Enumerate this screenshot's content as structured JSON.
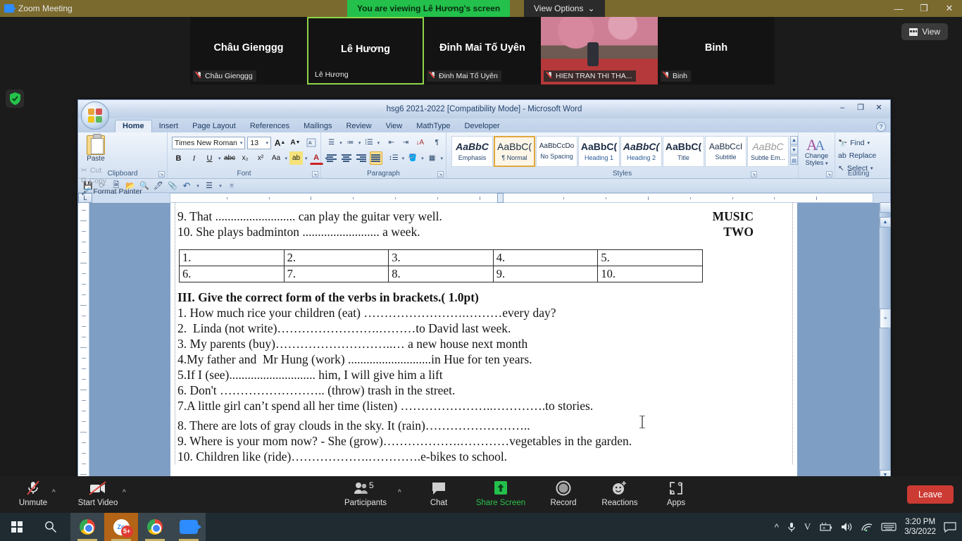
{
  "zoom_app": {
    "titlebar": {
      "app_title": "Zoom Meeting",
      "sharing_banner": "You are viewing Lê Hương's screen",
      "view_options": "View Options",
      "view_options_caret": "⌄",
      "minimize": "—",
      "restore": "❐",
      "close": "✕"
    },
    "view_pill": "View",
    "thumbnails": [
      {
        "big_name": "Châu Gienggg",
        "tag": "Châu Gienggg",
        "muted": true,
        "active": false,
        "has_video": false
      },
      {
        "big_name": "Lê Hương",
        "tag": "Lê Hương",
        "muted": false,
        "active": true,
        "has_video": false
      },
      {
        "big_name": "Đinh Mai Tố Uyên",
        "tag": "Đinh Mai Tố Uyên",
        "muted": true,
        "active": false,
        "has_video": false
      },
      {
        "big_name": "",
        "tag": "HIEN TRAN THI THA...",
        "muted": true,
        "active": false,
        "has_video": true
      },
      {
        "big_name": "Binh",
        "tag": "Binh",
        "muted": true,
        "active": false,
        "has_video": false
      }
    ],
    "toolbar": {
      "unmute": "Unmute",
      "start_video": "Start Video",
      "participants": "Participants",
      "participants_count": "5",
      "chat": "Chat",
      "share_screen": "Share Screen",
      "record": "Record",
      "reactions": "Reactions",
      "apps": "Apps",
      "leave": "Leave",
      "caret": "^"
    }
  },
  "word": {
    "titlebar": {
      "document_title": "hsg6 2021-2022 [Compatibility Mode] - Microsoft Word",
      "minimize": "–",
      "restore": "❐",
      "close": "✕",
      "help": "?"
    },
    "tabs": [
      {
        "label": "Home",
        "active": true
      },
      {
        "label": "Insert",
        "active": false
      },
      {
        "label": "Page Layout",
        "active": false
      },
      {
        "label": "References",
        "active": false
      },
      {
        "label": "Mailings",
        "active": false
      },
      {
        "label": "Review",
        "active": false
      },
      {
        "label": "View",
        "active": false
      },
      {
        "label": "MathType",
        "active": false
      },
      {
        "label": "Developer",
        "active": false
      }
    ],
    "ribbon": {
      "clipboard": {
        "group_label": "Clipboard",
        "paste": "Paste",
        "cut": "Cut",
        "copy": "Copy",
        "format_painter": "Format Painter"
      },
      "font": {
        "group_label": "Font",
        "font_name": "Times New Roman",
        "font_size": "13",
        "grow": "A",
        "shrink": "A",
        "clear_formatting": "Aa",
        "bold": "B",
        "italic": "I",
        "underline": "U",
        "strikethrough": "abc",
        "subscript": "x₂",
        "superscript": "x²",
        "change_case": "Aa",
        "highlight": "ab",
        "font_color": "A"
      },
      "paragraph": {
        "group_label": "Paragraph"
      },
      "styles": {
        "group_label": "Styles",
        "gallery": [
          {
            "preview": "AaBbC",
            "name": "Emphasis",
            "selected": false
          },
          {
            "preview": "AaBbC(",
            "name": "¶ Normal",
            "selected": true
          },
          {
            "preview": "AaBbCcDo",
            "name": "No Spacing",
            "selected": false
          },
          {
            "preview": "AaBbC(",
            "name": "Heading 1",
            "selected": false
          },
          {
            "preview": "AaBbC(",
            "name": "Heading 2",
            "selected": false
          },
          {
            "preview": "AaBbC(",
            "name": "Title",
            "selected": false
          },
          {
            "preview": "AaBbCcI",
            "name": "Subtitle",
            "selected": false
          },
          {
            "preview": "AaBbC",
            "name": "Subtle Em...",
            "selected": false
          }
        ],
        "change_styles": "Change Styles"
      },
      "editing": {
        "group_label": "Editing",
        "find": "Find",
        "replace": "Replace",
        "select": "Select"
      }
    },
    "tab_selector": "L",
    "document": {
      "lines_top": [
        {
          "left": "9. That .......................... can play the guitar very well.",
          "right": "MUSIC"
        },
        {
          "left": "10. She plays badminton ......................... a week.",
          "right": "TWO"
        }
      ],
      "answer_table": [
        [
          "1.",
          "2.",
          "3.",
          "4.",
          "5."
        ],
        [
          "6.",
          "7.",
          "8.",
          "9.",
          "10."
        ]
      ],
      "section_heading": "III. Give the correct form of the verbs in brackets.( 1.0pt)",
      "questions": [
        "1. How much rice your children (eat) …………………….………every day?",
        "2.  Linda (not write)…………………….………to David last week.",
        "3. My parents (buy)………………………..… a new house next month",
        "4.My father and  Mr Hung (work) ...........................in Hue for ten years.",
        "5.If I (see)............................ him, I will give him a lift",
        "6. Don't …………………….. (throw) trash in the street.",
        "7.A little girl can’t spend all her time (listen) …………………..………….to stories.",
        "8. There are lots of gray clouds in the sky. It (rain)……………………..",
        "9. Where is your mom now? - She (grow)……………….…………vegetables in the garden.",
        "10. Children like (ride)……………….………….e-bikes to school."
      ]
    }
  },
  "taskbar": {
    "start": "start-icon",
    "search": "search-icon",
    "apps": [
      {
        "name": "chrome-1",
        "state": "open"
      },
      {
        "name": "zoom-meeting",
        "state": "active",
        "badge": "5+"
      },
      {
        "name": "chrome-2",
        "state": "open"
      },
      {
        "name": "zoom-client",
        "state": "open"
      }
    ],
    "tray": {
      "show_hidden": "^",
      "mic": "mic-icon",
      "vietkey": "V",
      "battery": "battery-icon",
      "volume": "volume-icon",
      "network": "wifi-icon",
      "keyboard": "keyboard-icon",
      "time": "3:20 PM",
      "date": "3/3/2022",
      "notifications": "notification-icon"
    }
  }
}
